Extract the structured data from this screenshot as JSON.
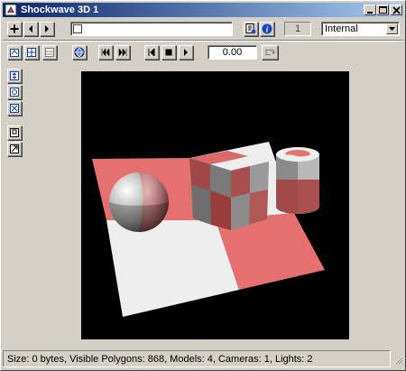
{
  "window": {
    "title": "Shockwave 3D 1"
  },
  "toolbar": {
    "name_value": "",
    "cast_number": "1",
    "renderer_selected": "Internal",
    "time_value": "0.00"
  },
  "status": {
    "text": "Size: 0 bytes, Visible Polygons: 868, Models: 4, Cameras: 1, Lights: 2"
  },
  "colors": {
    "scene_red": "#e67070",
    "scene_white": "#eeeeee",
    "background": "#000000"
  },
  "icons": [
    "app-icon",
    "minimize-icon",
    "maximize-icon",
    "close-icon",
    "plus-icon",
    "back-arrow-icon",
    "forward-arrow-icon",
    "script-icon",
    "info-icon",
    "camera-reset-icon",
    "dolly-icon",
    "rotate-icon",
    "pan-icon",
    "rewind-icon",
    "stop-icon",
    "play-icon",
    "loop-icon"
  ]
}
